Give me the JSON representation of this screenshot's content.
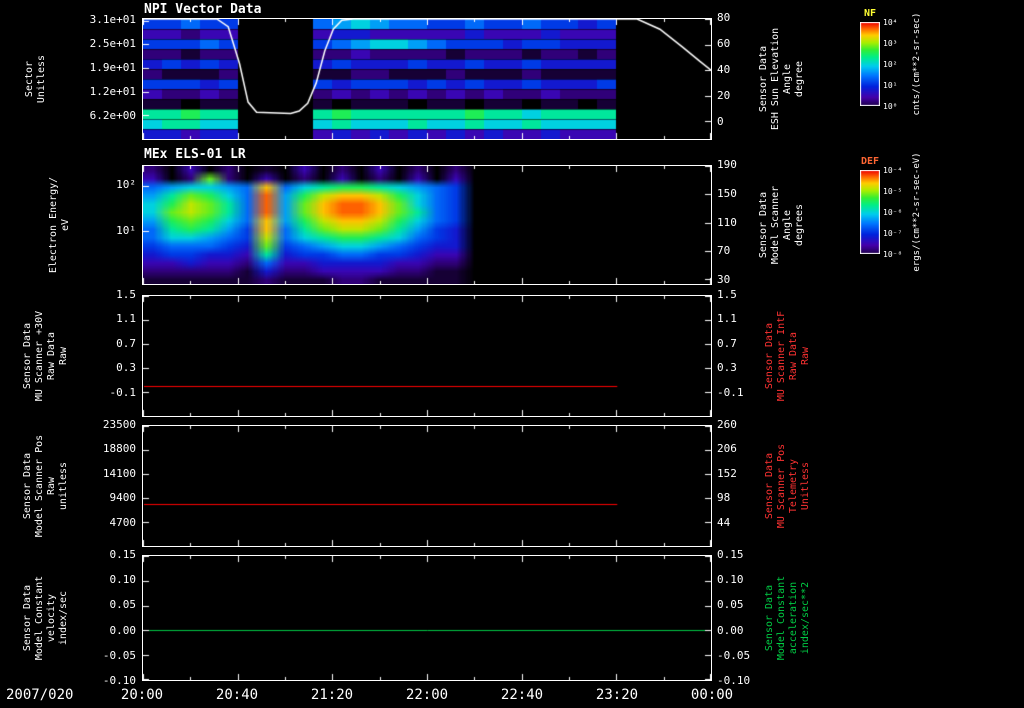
{
  "chart_data": {
    "type": "heatmap",
    "description": "Multi-panel time-series spectrogram plot, black background, 5 stacked panels sharing a common time axis",
    "x_axis": {
      "date_label": "2007/020",
      "tick_labels": [
        "20:00",
        "20:40",
        "21:20",
        "22:00",
        "22:40",
        "23:20",
        "00:00"
      ]
    },
    "colors": {
      "background": "#000000",
      "foreground": "#ffffff",
      "red_series": "#ff0000",
      "green_series": "#00c846",
      "red_label": "#ff3232",
      "green_label": "#00cc44"
    },
    "panels": [
      {
        "id": "npi-sector",
        "title": "NPI Vector Data",
        "type": "heatmap",
        "left_label_lines": [
          "Sector",
          "Unitless"
        ],
        "right_label_lines": [
          "Sensor Data",
          "ESH Sun Elevation",
          "Angle",
          "degree"
        ],
        "right_label_color": "#ffffff",
        "left_ticks": [
          {
            "label": "3.1e+01",
            "frac": 0.02
          },
          {
            "label": "2.5e+01",
            "frac": 0.21
          },
          {
            "label": "1.9e+01",
            "frac": 0.41
          },
          {
            "label": "1.2e+01",
            "frac": 0.61
          },
          {
            "label": "6.2e+00",
            "frac": 0.8
          }
        ],
        "right_ticks": [
          {
            "label": "80",
            "frac": 0.0
          },
          {
            "label": "60",
            "frac": 0.213
          },
          {
            "label": "40",
            "frac": 0.426
          },
          {
            "label": "20",
            "frac": 0.639
          },
          {
            "label": "0",
            "frac": 0.852
          }
        ],
        "heatmap": {
          "smooth": false,
          "row_gaps": true,
          "rows": [
            "556550000678766556556554500000",
            "332330000344333334333433300000",
            "555650000567887655545544400000",
            "221220000223222212221221200000",
            "454540000454445445445444400000",
            "211120000112211121112111100000",
            "555450000545554545445444500000",
            "322320000232323232322322200000",
            "110110000101110110110110100000",
            "99a9900009a999999a998999900000",
            "899880000898889889889888800000",
            "443440000343434343433433300000"
          ]
        },
        "overlay_line": {
          "color": "#ffffff",
          "v_max": 80,
          "zero_frac": 0.852,
          "points": [
            [
              0,
              80
            ],
            [
              0.13,
              80
            ],
            [
              0.15,
              74
            ],
            [
              0.17,
              45
            ],
            [
              0.185,
              15
            ],
            [
              0.2,
              7
            ],
            [
              0.26,
              6
            ],
            [
              0.275,
              8
            ],
            [
              0.29,
              14
            ],
            [
              0.305,
              30
            ],
            [
              0.32,
              55
            ],
            [
              0.335,
              72
            ],
            [
              0.35,
              79
            ],
            [
              0.37,
              80
            ],
            [
              0.87,
              80
            ],
            [
              0.91,
              72
            ],
            [
              0.95,
              58
            ],
            [
              0.98,
              47
            ],
            [
              1.0,
              40
            ]
          ]
        }
      },
      {
        "id": "els-energy",
        "title": "MEx ELS-01 LR",
        "type": "heatmap",
        "left_label_lines": [
          "Electron Energy/",
          "eV"
        ],
        "right_label_lines": [
          "Sensor Data",
          "Model Scanner",
          "Angle",
          "degrees"
        ],
        "right_label_color": "#ffffff",
        "left_ticks": [
          {
            "label": "10²",
            "frac": 0.17
          },
          {
            "label": "10¹",
            "frac": 0.55
          }
        ],
        "right_ticks": [
          {
            "label": "190",
            "frac": 0.0
          },
          {
            "label": "150",
            "frac": 0.24
          },
          {
            "label": "110",
            "frac": 0.48
          },
          {
            "label": "70",
            "frac": 0.72
          },
          {
            "label": "30",
            "frac": 0.96
          }
        ],
        "heatmap": {
          "smooth": true,
          "row_gaps": false,
          "rows": [
            "203020103020302020000000000000",
            "302b20302030203030000000000000",
            "678876d689aa987650000000000000",
            "79ba86e7acddca8650000000000000",
            "8acb96e7bdeedb8650000000000000",
            "8bcb96e7bdeedb9650000000000000",
            "7aba86d7acddca8650000000000000",
            "69a975d69bccb97540000000000000",
            "688765c689aa986540000000000000",
            "566654b56788765440000000000000",
            "455443945566554330000000000000",
            "334332633444433220000000000000",
            "222221422333322110000000000000",
            "111111211122111110000000000000"
          ]
        }
      },
      {
        "id": "mu-scanner-30v",
        "type": "line",
        "left_label_lines": [
          "Sensor Data",
          "MU Scanner +30V",
          "Raw Data",
          "Raw"
        ],
        "right_label_lines": [
          "Sensor Data",
          "MU Scanner IntF",
          "Raw Data",
          "Raw"
        ],
        "right_label_color": "#ff3232",
        "left_ticks": [
          {
            "label": "1.5",
            "frac": 0.0
          },
          {
            "label": "1.1",
            "frac": 0.2
          },
          {
            "label": "0.7",
            "frac": 0.4
          },
          {
            "label": "0.3",
            "frac": 0.6
          },
          {
            "label": "-0.1",
            "frac": 0.8
          }
        ],
        "right_ticks": [
          {
            "label": "1.5",
            "frac": 0.0
          },
          {
            "label": "1.1",
            "frac": 0.2
          },
          {
            "label": "0.7",
            "frac": 0.4
          },
          {
            "label": "0.3",
            "frac": 0.6
          },
          {
            "label": "-0.1",
            "frac": 0.8
          }
        ],
        "scale": {
          "top_value": 1.5,
          "bottom_value": -0.1,
          "bottom_frac": 0.8
        },
        "line": {
          "color": "#ff0000",
          "value": 0.0,
          "end_frac": 0.835
        }
      },
      {
        "id": "model-scanner-pos",
        "type": "line",
        "left_label_lines": [
          "Sensor Data",
          "Model Scanner Pos",
          "Raw",
          "unitless"
        ],
        "right_label_lines": [
          "Sensor Data",
          "MU Scanner Pos",
          "Telemetry",
          "Unitless"
        ],
        "right_label_color": "#ff3232",
        "left_ticks": [
          {
            "label": "23500",
            "frac": 0.0
          },
          {
            "label": "18800",
            "frac": 0.2
          },
          {
            "label": "14100",
            "frac": 0.4
          },
          {
            "label": "9400",
            "frac": 0.6
          },
          {
            "label": "4700",
            "frac": 0.8
          }
        ],
        "right_ticks": [
          {
            "label": "260",
            "frac": 0.0
          },
          {
            "label": "206",
            "frac": 0.2
          },
          {
            "label": "152",
            "frac": 0.4
          },
          {
            "label": "98",
            "frac": 0.6
          },
          {
            "label": "44",
            "frac": 0.8
          }
        ],
        "scale": {
          "top_value": 23500,
          "bottom_value": 4700,
          "bottom_frac": 0.8
        },
        "line": {
          "color": "#ff0000",
          "value": 8200,
          "end_frac": 0.835
        }
      },
      {
        "id": "model-constant-velocity",
        "type": "line",
        "left_label_lines": [
          "Sensor Data",
          "Model Constant",
          "velocity",
          "index/sec"
        ],
        "right_label_lines": [
          "Sensor Data",
          "Model Constant",
          "acceleration",
          "index/sec**2"
        ],
        "right_label_color": "#00cc44",
        "left_ticks": [
          {
            "label": "0.15",
            "frac": 0.0
          },
          {
            "label": "0.10",
            "frac": 0.2
          },
          {
            "label": "0.05",
            "frac": 0.4
          },
          {
            "label": "0.00",
            "frac": 0.6
          },
          {
            "label": "-0.05",
            "frac": 0.8
          },
          {
            "label": "-0.10",
            "frac": 1.0
          }
        ],
        "right_ticks": [
          {
            "label": "0.15",
            "frac": 0.0
          },
          {
            "label": "0.10",
            "frac": 0.2
          },
          {
            "label": "0.05",
            "frac": 0.4
          },
          {
            "label": "0.00",
            "frac": 0.6
          },
          {
            "label": "-0.05",
            "frac": 0.8
          },
          {
            "label": "-0.10",
            "frac": 1.0
          }
        ],
        "scale": {
          "top_value": 0.15,
          "bottom_value": -0.1,
          "bottom_frac": 1.0
        },
        "line": {
          "color": "#00c846",
          "value": 0.0,
          "end_frac": 1.0
        }
      }
    ],
    "colorbars": [
      {
        "id": "NF",
        "label": "NF",
        "label_color": "#ffff33",
        "ticks": [
          "10⁴",
          "10³",
          "10²",
          "10¹",
          "10⁰"
        ],
        "unit": "cnts/(cm**2-sr-sec)"
      },
      {
        "id": "DEF",
        "label": "DEF",
        "label_color": "#ff6633",
        "ticks": [
          "10⁻⁴",
          "10⁻⁵",
          "10⁻⁶",
          "10⁻⁷",
          "10⁻⁸"
        ],
        "unit": "ergs/(cm**2-sr-sec-eV)"
      }
    ]
  }
}
